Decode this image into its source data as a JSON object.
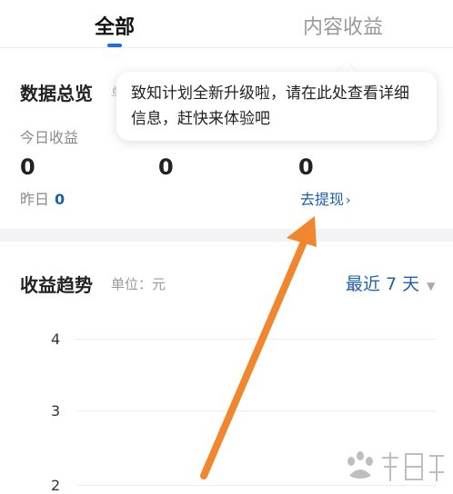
{
  "tabs": [
    {
      "label": "全部"
    },
    {
      "label": "内容收益"
    }
  ],
  "overview": {
    "title": "数据总览",
    "title_peek": "单",
    "today_label": "今日收益",
    "values": [
      "0",
      "0",
      "0"
    ],
    "yesterday_label": "昨日",
    "yesterday_value": "0",
    "withdraw_label": "去提现",
    "withdraw_chevron": "›"
  },
  "tooltip": {
    "text": "致知计划全新升级啦，请在此处查看详细信息，赶快来体验吧"
  },
  "trend": {
    "title": "收益趋势",
    "unit": "单位：元",
    "range": "最近 7 天",
    "range_caret": "▼"
  },
  "chart_data": {
    "type": "line",
    "title": "收益趋势",
    "y_ticks": [
      "4",
      "3",
      "2"
    ],
    "series": []
  },
  "colors": {
    "accent": "#1e6fd9",
    "link": "#1e5fa8",
    "annotation_arrow": "#f0872e"
  }
}
